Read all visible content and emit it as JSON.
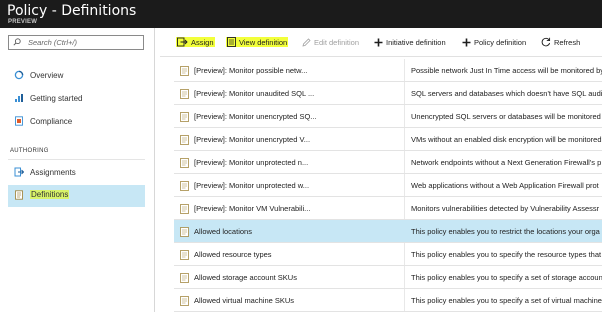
{
  "header": {
    "title": "Policy - Definitions",
    "subtitle": "PREVIEW"
  },
  "search": {
    "placeholder": "Search (Ctrl+/)"
  },
  "nav": {
    "items": [
      {
        "label": "Overview"
      },
      {
        "label": "Getting started"
      },
      {
        "label": "Compliance"
      }
    ],
    "section": "AUTHORING",
    "authoring": [
      {
        "label": "Assignments"
      },
      {
        "label": "Definitions"
      }
    ]
  },
  "toolbar": {
    "assign": "Assign",
    "view_definition": "View definition",
    "edit_definition": "Edit definition",
    "initiative_definition": "Initiative definition",
    "policy_definition": "Policy definition",
    "refresh": "Refresh"
  },
  "rows": [
    {
      "name": "[Preview]: Monitor possible netw...",
      "description": "Possible network Just In Time access will be monitored by"
    },
    {
      "name": "[Preview]: Monitor unaudited SQL ...",
      "description": "SQL servers and databases which doesn't have SQL auditi"
    },
    {
      "name": "[Preview]: Monitor unencrypted SQ...",
      "description": "Unencrypted SQL servers or databases will be monitored"
    },
    {
      "name": "[Preview]: Monitor unencrypted V...",
      "description": "VMs without an enabled disk encryption will be monitored"
    },
    {
      "name": "[Preview]: Monitor unprotected n...",
      "description": "Network endpoints without a Next Generation Firewall's p"
    },
    {
      "name": "[Preview]: Monitor unprotected w...",
      "description": "Web applications without a Web Application Firewall prot"
    },
    {
      "name": "[Preview]: Monitor VM Vulnerabili...",
      "description": "Monitors vulnerabilities detected by Vulnerability Assessr"
    },
    {
      "name": "Allowed locations",
      "description": "This policy enables you to restrict the locations your orga"
    },
    {
      "name": "Allowed resource types",
      "description": "This policy enables you to specify the resource types that"
    },
    {
      "name": "Allowed storage account SKUs",
      "description": "This policy enables you to specify a set of storage accoun"
    },
    {
      "name": "Allowed virtual machine SKUs",
      "description": "This policy enables you to specify a set of virtual machine"
    }
  ],
  "selected_row": "Allowed locations",
  "colors": {
    "header_bg": "#1b1b1b",
    "selection": "#c7e7f5",
    "highlight": "#f2ff3a"
  }
}
